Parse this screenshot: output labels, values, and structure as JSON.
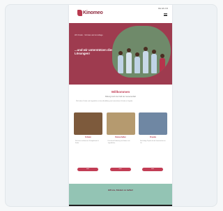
{
  "header": {
    "logo_text": "Kinomeo",
    "lang": "DE EN FR",
    "menu_icon": "hamburger-icon"
  },
  "hero": {
    "intro": "Wir Kinder - Schulen als Grundlage",
    "slogan": "...und wir unterstützen diese Lösungen!"
  },
  "intro_section": {
    "title": "Willkommen",
    "subtitle": "Bildung durch die Kraft der Gemeinschaft",
    "paragraph": "Wir fördern Kinder und Jugendliche in ihrer Ausbildung und unterstützen Schulen in Uganda."
  },
  "projects": [
    {
      "title": "Schulen",
      "text": "Wir bauen und betreuen Schulgebäude für Kinder.",
      "button": "mehr",
      "color": "#7d5a3c"
    },
    {
      "title": "Patenschaften",
      "text": "Persönliche Förderung von Kindern und Jugendlichen.",
      "button": "mehr",
      "color": "#b59a6f"
    },
    {
      "title": "Projekte",
      "text": "Nachhaltige Projekte für die Gemeinschaft vor Ort.",
      "button": "mehr",
      "color": "#6f87a3"
    }
  ],
  "footer_banner": {
    "text": "Hilf uns, Kindern zu helfen!"
  },
  "colors": {
    "brand": "#9e3b4f",
    "accent": "#c23d55",
    "mint": "#93c4b4",
    "dark": "#1f1f1f"
  }
}
